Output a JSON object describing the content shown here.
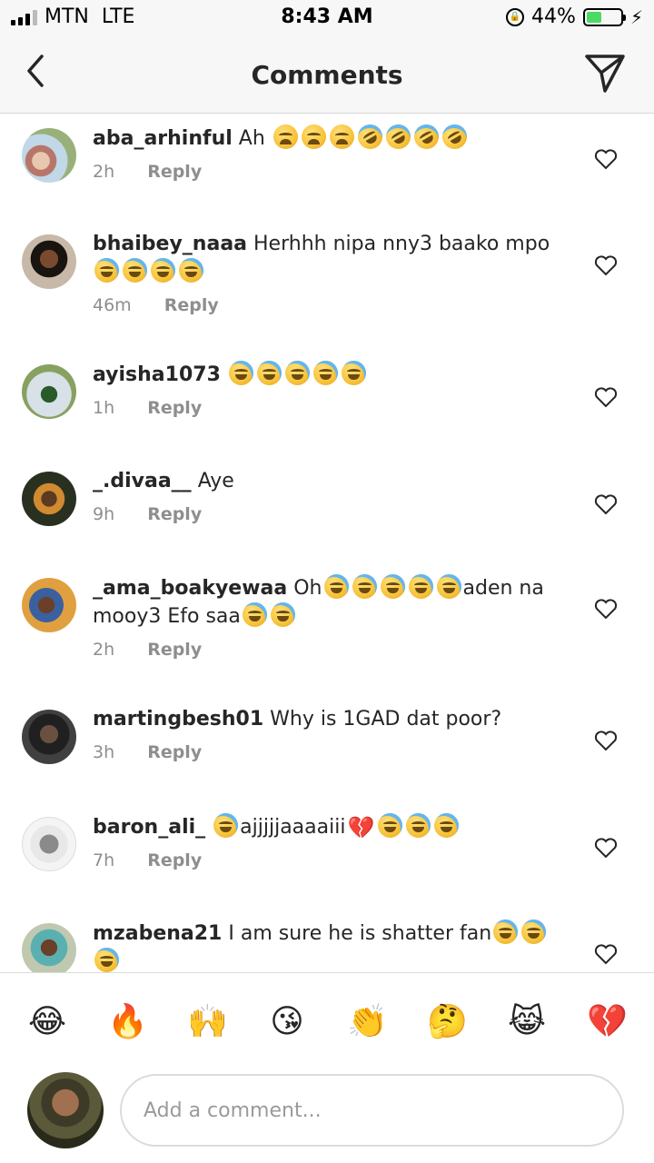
{
  "status_bar": {
    "carrier": "MTN",
    "network": "LTE",
    "time": "8:43 AM",
    "battery_percent": "44%",
    "battery_level": 0.44,
    "battery_color": "#4cd964"
  },
  "header": {
    "title": "Comments",
    "back_icon": "chevron-left-icon",
    "send_icon": "paper-plane-icon"
  },
  "comments": [
    {
      "username": "aba_arhinful",
      "text": "Ah",
      "emojis": [
        "weary",
        "weary",
        "weary",
        "rofl",
        "rofl",
        "rofl",
        "rofl"
      ],
      "time": "2h",
      "reply": "Reply"
    },
    {
      "username": "bhaibey_naaa",
      "text": "Herhhh nipa nny3 baako mpo",
      "emojis": [
        "tears",
        "tears",
        "tears",
        "tears"
      ],
      "time": "46m",
      "reply": "Reply"
    },
    {
      "username": "ayisha1073",
      "text": "",
      "emojis": [
        "tears",
        "tears",
        "tears",
        "tears",
        "tears"
      ],
      "time": "1h",
      "reply": "Reply"
    },
    {
      "username": "_.divaa__",
      "text": "Aye",
      "emojis": [],
      "time": "9h",
      "reply": "Reply"
    },
    {
      "username": "_ama_boakyewaa",
      "text_before": "Oh",
      "text_after": "aden na mooy3 Efo saa",
      "emojis": [
        "tears",
        "tears",
        "tears",
        "tears",
        "tears"
      ],
      "emojis_end": [
        "tears",
        "tears"
      ],
      "time": "2h",
      "reply": "Reply"
    },
    {
      "username": "martingbesh01",
      "text": "Why is 1GAD dat poor?",
      "emojis": [],
      "time": "3h",
      "reply": "Reply"
    },
    {
      "username": "baron_ali_",
      "text": "ajjjjjaaaaiii",
      "emojis": [
        "tears"
      ],
      "emojis_end": [
        "tears",
        "tears",
        "tears"
      ],
      "time": "7h",
      "reply": "Reply"
    },
    {
      "username": "mzabena21",
      "text": "I am sure he is shatter fan",
      "emojis": [
        "tears",
        "tears",
        "tears"
      ],
      "time": "",
      "reply": ""
    }
  ],
  "emoji_bar": [
    "😂",
    "🔥",
    "🙌",
    "😘",
    "👏",
    "🤔",
    "😹",
    "💔"
  ],
  "input": {
    "placeholder": "Add a comment..."
  }
}
